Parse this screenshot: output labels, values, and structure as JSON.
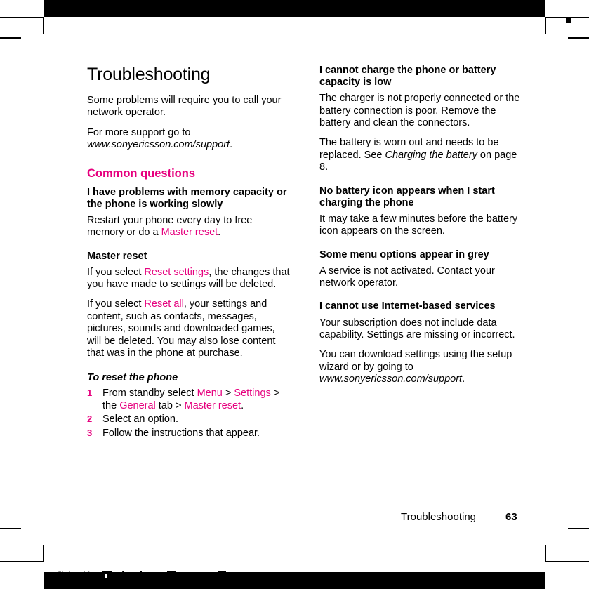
{
  "document": {
    "chapter_title": "Troubleshooting",
    "footer_label": "Troubleshooting",
    "page_number": "63"
  },
  "left_column": {
    "intro1": "Some problems will require you to call your network operator.",
    "intro2_prefix": "For more support go to ",
    "intro2_url": "www.sonyericsson.com/support",
    "intro2_suffix": ".",
    "section_heading": "Common questions",
    "q1_heading": "I have problems with memory capacity or the phone is working slowly",
    "q1_body_prefix": "Restart your phone every day to free memory or do a ",
    "q1_body_link": "Master reset",
    "q1_body_suffix": ".",
    "q2_heading": "Master reset",
    "q2_body1_prefix": "If you select ",
    "q2_body1_link": "Reset settings",
    "q2_body1_suffix": ", the changes that you have made to settings will be deleted.",
    "q2_body2_prefix": "If you select ",
    "q2_body2_link": "Reset all",
    "q2_body2_suffix": ", your settings and content, such as contacts, messages, pictures, sounds and downloaded games, will be deleted. You may also lose content that was in the phone at purchase.",
    "task_heading": "To reset the phone",
    "steps": [
      {
        "num": "1",
        "parts": [
          {
            "text": "From standby select ",
            "style": "plain"
          },
          {
            "text": "Menu",
            "style": "ui"
          },
          {
            "text": " > ",
            "style": "plain"
          },
          {
            "text": "Settings",
            "style": "ui"
          },
          {
            "text": " > the ",
            "style": "plain"
          },
          {
            "text": "General",
            "style": "ui"
          },
          {
            "text": " tab > ",
            "style": "plain"
          },
          {
            "text": "Master reset",
            "style": "ui"
          },
          {
            "text": ".",
            "style": "plain"
          }
        ]
      },
      {
        "num": "2",
        "parts": [
          {
            "text": "Select an option.",
            "style": "plain"
          }
        ]
      },
      {
        "num": "3",
        "parts": [
          {
            "text": "Follow the instructions that appear.",
            "style": "plain"
          }
        ]
      }
    ]
  },
  "right_column": {
    "q1_heading": "I cannot charge the phone or battery capacity is low",
    "q1_body1": "The charger is not properly connected or the battery connection is poor. Remove the battery and clean the connectors.",
    "q1_body2_prefix": "The battery is worn out and needs to be replaced. See ",
    "q1_body2_italic": "Charging the battery",
    "q1_body2_suffix": " on page 8.",
    "q2_heading": "No battery icon appears when I start charging the phone",
    "q2_body": "It may take a few minutes before the battery icon appears on the screen.",
    "q3_heading": "Some menu options appear in grey",
    "q3_body": "A service is not activated. Contact your network operator.",
    "q4_heading": "I cannot use Internet-based services",
    "q4_body1": "Your subscription does not include data capability. Settings are missing or incorrect.",
    "q4_body2_prefix": "You can download settings using the setup wizard or by going to ",
    "q4_body2_url": "www.sonyericsson.com/support",
    "q4_body2_suffix": "."
  },
  "preflight_bar": {
    "text": "Preflighted by",
    "logo": "Elanders",
    "passed_label": "PASSED",
    "failed_label": "FAILED"
  },
  "colors": {
    "accent": "#e6007e",
    "text": "#000000",
    "background": "#ffffff"
  }
}
